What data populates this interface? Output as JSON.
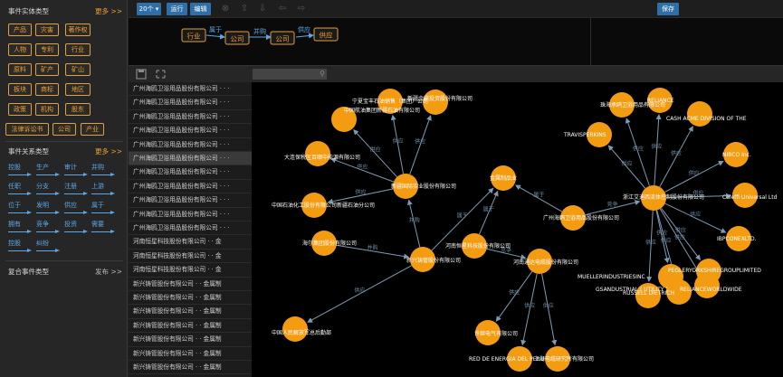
{
  "sidebar": {
    "entity_types_title": "事件实体类型",
    "entity_more": "更多 >>",
    "entity_tags": [
      "产品",
      "灾害",
      "著作权",
      "人物",
      "专利",
      "行业",
      "原料",
      "矿产",
      "矿山",
      "板块",
      "商标",
      "地区",
      "政策",
      "机构",
      "股东",
      "法律诉讼书",
      "公司",
      "产业"
    ],
    "relation_types_title": "事件关系类型",
    "relation_more": "更多 >>",
    "relations": [
      "控股",
      "生产",
      "审计",
      "并购",
      "任职",
      "分支",
      "注册",
      "上游",
      "位于",
      "发明",
      "供应",
      "属于",
      "拥有",
      "竞争",
      "投资",
      "需要",
      "控股",
      "纠纷"
    ],
    "compound_title": "复合事件类型",
    "compound_action": "发布 >>"
  },
  "toolbar": {
    "count": "20个 ▾",
    "run": "运行",
    "edit": "编辑",
    "save": "保存",
    "icons": [
      "cancel-icon",
      "upload-icon",
      "download-icon",
      "undo-icon",
      "redo-icon"
    ]
  },
  "pattern": {
    "nodes": [
      "行业",
      "公司",
      "公司",
      "供应"
    ],
    "edges": [
      "属于",
      "并购",
      "供应"
    ]
  },
  "list": {
    "rows": [
      "广州海鸥卫浴用品股份有限公司 · · ·",
      "广州海鸥卫浴用品股份有限公司 · · ·",
      "广州海鸥卫浴用品股份有限公司 · · ·",
      "广州海鸥卫浴用品股份有限公司 · · ·",
      "广州海鸥卫浴用品股份有限公司 · · ·",
      "广州海鸥卫浴用品股份有限公司 · · ·",
      "广州海鸥卫浴用品股份有限公司 · · ·",
      "广州海鸥卫浴用品股份有限公司 · · ·",
      "广州海鸥卫浴用品股份有限公司 · · ·",
      "广州海鸥卫浴用品股份有限公司 · · ·",
      "广州海鸥卫浴用品股份有限公司 · · ·",
      "河南恒星科技股份有限公司 · · 金",
      "河南恒星科技股份有限公司 · · 金",
      "河南恒星科技股份有限公司 · · 金",
      "新兴铸管股份有限公司 · · 金属制",
      "新兴铸管股份有限公司 · · 金属制",
      "新兴铸管股份有限公司 · · 金属制",
      "新兴铸管股份有限公司 · · 金属制",
      "新兴铸管股份有限公司 · · 金属制",
      "新兴铸管股份有限公司 · · 金属制",
      "新兴铸管股份有限公司 · · 金属制"
    ],
    "selected_index": 5
  },
  "graph": {
    "nodes": [
      {
        "id": "a",
        "label": "中国航油集团新疆石油有限公司"
      },
      {
        "id": "b",
        "label": "宁夏宝丰石油销售（集团）公司"
      },
      {
        "id": "c",
        "label": "新疆金鼎投资股份有限公司"
      },
      {
        "id": "d",
        "label": "大连保税区百顺中能源有限公司"
      },
      {
        "id": "e",
        "label": "新疆国际实业股份有限公司"
      },
      {
        "id": "f",
        "label": "中国石油化工股份有限公司新疆石油分公司"
      },
      {
        "id": "g",
        "label": "金属制品业"
      },
      {
        "id": "h",
        "label": "海尔集团股份有限公司"
      },
      {
        "id": "i",
        "label": "新兴铸管股份有限公司"
      },
      {
        "id": "j",
        "label": "河南恒星科技股份有限公司"
      },
      {
        "id": "k",
        "label": "中国人民解放军总后勤部"
      },
      {
        "id": "l",
        "label": "河南通达电缆股份有限公司"
      },
      {
        "id": "m",
        "label": "许继电气有限公司"
      },
      {
        "id": "n",
        "label": "RED DE ENERGIA DEL PERU"
      },
      {
        "id": "o",
        "label": "上海电缆研究所有限公司"
      },
      {
        "id": "p",
        "label": "广州海鸥卫浴用品股份有限公司"
      },
      {
        "id": "q",
        "label": "TRAVISPERKINS"
      },
      {
        "id": "r",
        "label": "珠海承鸥卫浴用品有限公司"
      },
      {
        "id": "s",
        "label": "RELIANCE"
      },
      {
        "id": "t",
        "label": "CASH ACME DIVISION OF THE"
      },
      {
        "id": "u",
        "label": "NIBCO Inc."
      },
      {
        "id": "v",
        "label": "Caleffi Universal Ltd"
      },
      {
        "id": "w",
        "label": "IBPCONEXLTD."
      },
      {
        "id": "x",
        "label": "PEGLERYORKSHIREGROUPLIMITED"
      },
      {
        "id": "y",
        "label": "RELIANCEWORLDWIDE"
      },
      {
        "id": "z",
        "label": "MUELLERINDUSTRIESINC"
      },
      {
        "id": "aa",
        "label": "GSANDUSTRIAL ( UTILITY )"
      },
      {
        "id": "ab",
        "label": "RUSSELL DIETRICH"
      },
      {
        "id": "ac",
        "label": "浙江艾迪西流体控制股份有限公司"
      }
    ],
    "edges": [
      {
        "from": "e",
        "to": "a",
        "label": "供应"
      },
      {
        "from": "e",
        "to": "b",
        "label": "供应"
      },
      {
        "from": "e",
        "to": "c",
        "label": "供应"
      },
      {
        "from": "e",
        "to": "d",
        "label": "供应"
      },
      {
        "from": "e",
        "to": "f",
        "label": "供应"
      },
      {
        "from": "i",
        "to": "e",
        "label": "并购"
      },
      {
        "from": "i",
        "to": "g",
        "label": "属于"
      },
      {
        "from": "h",
        "to": "i",
        "label": "并购"
      },
      {
        "from": "i",
        "to": "k",
        "label": "供应"
      },
      {
        "from": "j",
        "to": "g",
        "label": "属于"
      },
      {
        "from": "j",
        "to": "l",
        "label": "竞争"
      },
      {
        "from": "p",
        "to": "g",
        "label": "属于"
      },
      {
        "from": "l",
        "to": "m",
        "label": "供应"
      },
      {
        "from": "l",
        "to": "n",
        "label": "供应"
      },
      {
        "from": "l",
        "to": "o",
        "label": "供应"
      },
      {
        "from": "p",
        "to": "ac",
        "label": "竞争"
      },
      {
        "from": "ac",
        "to": "q",
        "label": "供应"
      },
      {
        "from": "ac",
        "to": "r",
        "label": "供应"
      },
      {
        "from": "ac",
        "to": "s",
        "label": "供应"
      },
      {
        "from": "ac",
        "to": "t",
        "label": "供应"
      },
      {
        "from": "ac",
        "to": "u",
        "label": "供应"
      },
      {
        "from": "ac",
        "to": "v",
        "label": "供应"
      },
      {
        "from": "ac",
        "to": "w",
        "label": "供应"
      },
      {
        "from": "ac",
        "to": "x",
        "label": "供应"
      },
      {
        "from": "ac",
        "to": "y",
        "label": "供应"
      },
      {
        "from": "ac",
        "to": "z",
        "label": "供应"
      },
      {
        "from": "ac",
        "to": "aa",
        "label": "供应"
      },
      {
        "from": "ac",
        "to": "ab",
        "label": "供应"
      }
    ]
  },
  "colors": {
    "node": "#f39c12",
    "accent": "#2f6fa8",
    "edge": "#7f9bb3",
    "tag": "#f0a030",
    "relation": "#5aa8e8"
  }
}
